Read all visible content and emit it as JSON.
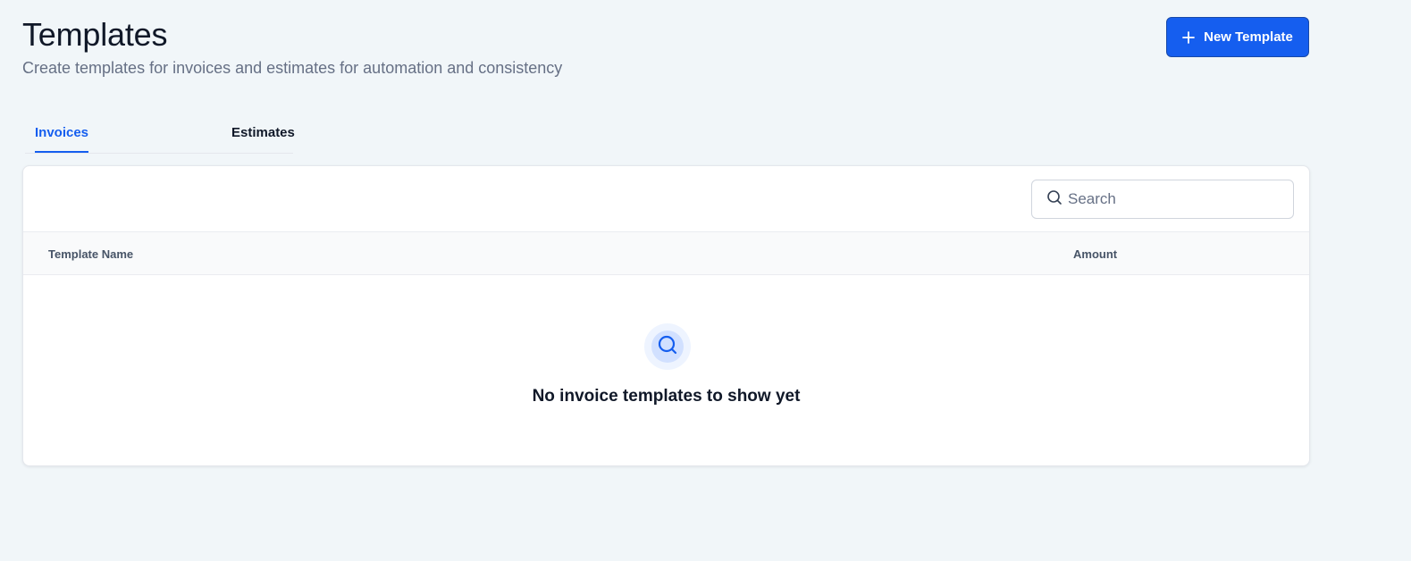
{
  "header": {
    "title": "Templates",
    "subtitle": "Create templates for invoices and estimates for automation and consistency",
    "new_template_label": "New Template",
    "new_template_icon": "plus-icon"
  },
  "tabs": [
    {
      "label": "Invoices",
      "active": true
    },
    {
      "label": "Estimates",
      "active": false
    }
  ],
  "search": {
    "placeholder": "Search",
    "value": "",
    "icon": "search-icon"
  },
  "table": {
    "columns": [
      "Template Name",
      "Amount"
    ],
    "rows": []
  },
  "empty_state": {
    "icon": "search-icon",
    "message": "No invoice templates to show yet"
  },
  "colors": {
    "accent": "#155eef",
    "background": "#f1f6f9",
    "text": "#101828",
    "muted": "#667085"
  }
}
